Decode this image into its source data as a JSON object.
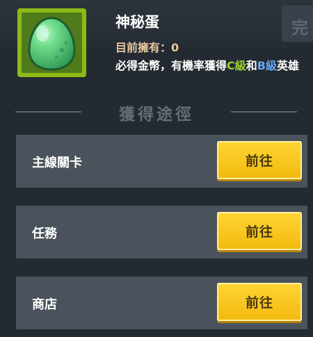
{
  "header": {
    "faded_button_label": "完"
  },
  "item": {
    "icon": "green-egg-icon",
    "title": "神秘蛋",
    "owned_label": "目前擁有：",
    "owned_count": "0",
    "desc_prefix": "必得金幣，有機率獲得",
    "grade_c": "C級",
    "desc_and": "和",
    "grade_b": "B級",
    "desc_suffix": "英雄"
  },
  "section": {
    "title": "獲得途徑"
  },
  "sources": [
    {
      "label": "主線關卡",
      "button": "前往"
    },
    {
      "label": "任務",
      "button": "前往"
    },
    {
      "label": "商店",
      "button": "前往"
    }
  ],
  "colors": {
    "grade_c": "#9ad42c",
    "grade_b": "#67a6f2",
    "button": "#ffd534",
    "row_bg": "#4a525b"
  }
}
